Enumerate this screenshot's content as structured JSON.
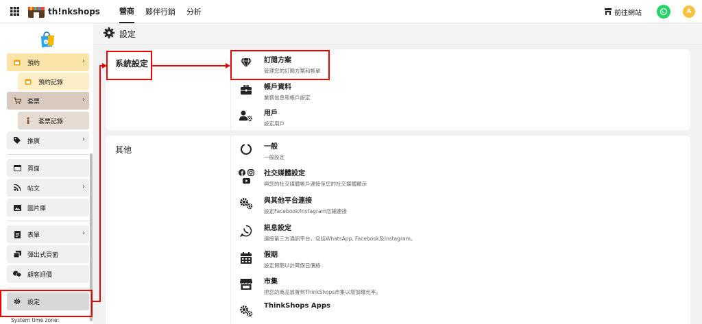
{
  "topbar": {
    "logo_text": "th!nkshops",
    "nav": [
      {
        "label": "營商",
        "active": true
      },
      {
        "label": "夥伴行銷",
        "active": false
      },
      {
        "label": "分析",
        "active": false
      }
    ],
    "visit_site_label": "前往網站",
    "avatar_letter": "A"
  },
  "sidebar": {
    "items": [
      {
        "label": "預約",
        "icon": "calendar-icon",
        "has_chevron": true
      },
      {
        "label": "預約記錄",
        "icon": "calendar-icon"
      },
      {
        "label": "套票",
        "icon": "cart-icon",
        "has_chevron": true
      },
      {
        "label": "套票記錄",
        "icon": "person-icon"
      },
      {
        "label": "推廣",
        "icon": "tag-icon",
        "has_chevron": true
      },
      {
        "label": "頁面",
        "icon": "window-icon"
      },
      {
        "label": "帖文",
        "icon": "rss-icon",
        "has_chevron": true
      },
      {
        "label": "圖片庫",
        "icon": "image-icon"
      },
      {
        "label": "表單",
        "icon": "form-icon",
        "has_chevron": true
      },
      {
        "label": "彈出式頁面",
        "icon": "popup-icon"
      },
      {
        "label": "顧客評價",
        "icon": "review-icon"
      },
      {
        "label": "設定",
        "icon": "gear-icon",
        "selected": true
      }
    ],
    "timezone": "System time zone: Asia/Hong_kong"
  },
  "page": {
    "title": "設定"
  },
  "system_settings": {
    "label": "系統設定",
    "options": [
      {
        "title": "訂閱方案",
        "desc": "管理您的訂閱方案和帳單",
        "icon": "diamond-icon"
      },
      {
        "title": "帳戶資料",
        "desc": "業務信息和帳戶設定",
        "icon": "briefcase-icon"
      },
      {
        "title": "用戶",
        "desc": "設定用戶",
        "icon": "user-gear-icon"
      }
    ]
  },
  "others": {
    "label": "其他",
    "options": [
      {
        "title": "一般",
        "desc": "一般設定",
        "icon": "circle-notch-icon"
      },
      {
        "title": "社交媒體設定",
        "desc": "與您的社交媒體帳戶連接至您的社交媒體顯示",
        "icon": "social-icons"
      },
      {
        "title": "與其他平台連接",
        "desc": "設定Facebook/Instagram店鋪連接",
        "icon": "gears-icon"
      },
      {
        "title": "訊息設定",
        "desc": "連接第三方通訊平台，包括WhatsApp, Facebook及Instagram。",
        "icon": "whatsapp-icon"
      },
      {
        "title": "假期",
        "desc": "設定假期以計算假日價格",
        "icon": "calendar-icon"
      },
      {
        "title": "市集",
        "desc": "把您的商品放置到ThinkShops市集以增加曝光率。",
        "icon": "store-icon"
      },
      {
        "title": "ThinkShops Apps",
        "desc": "",
        "icon": "gears-icon"
      }
    ]
  },
  "colors": {
    "annotation_red": "#ee0000",
    "whatsapp_green": "#25d366",
    "avatar_yellow": "#f9c23c"
  }
}
